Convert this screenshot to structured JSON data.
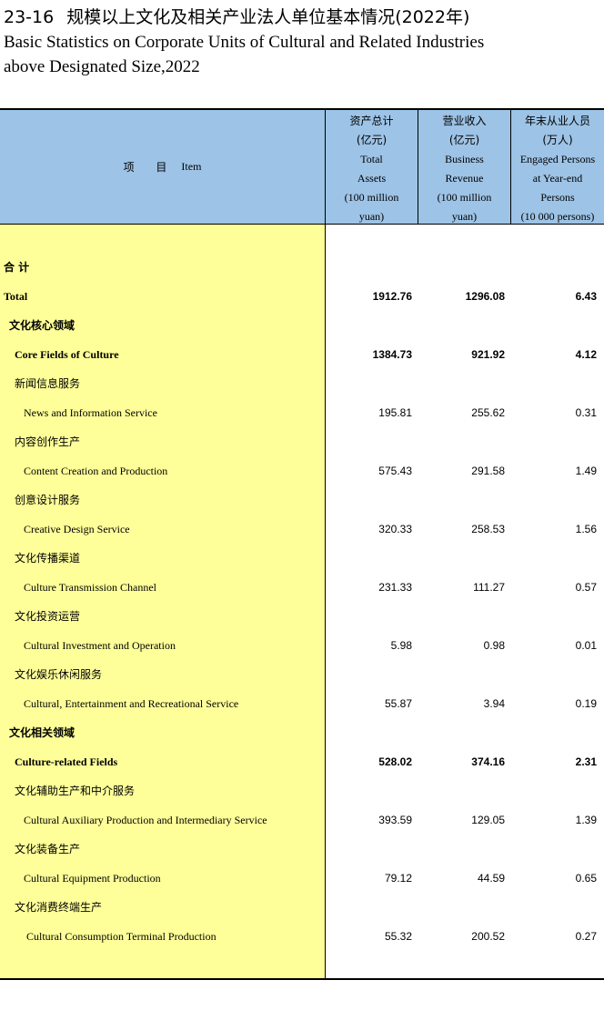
{
  "title": {
    "number": "23-16",
    "cn": "规模以上文化及相关产业法人单位基本情况(2022年)",
    "en_line1": "Basic Statistics on Corporate Units of Cultural and Related Industries",
    "en_line2": "above Designated Size,2022"
  },
  "header": {
    "item_cn": "项 目",
    "item_en": "Item",
    "col1": [
      "资产总计",
      "(亿元)",
      "Total",
      "Assets",
      "(100 million",
      "yuan)"
    ],
    "col2": [
      "营业收入",
      "(亿元)",
      "Business",
      "Revenue",
      "(100 million",
      "yuan)"
    ],
    "col3": [
      "年末从业人员",
      "(万人)",
      "Engaged Persons",
      "at Year-end",
      "Persons",
      "(10 000 persons)"
    ]
  },
  "rows": [
    {
      "label": "合 计",
      "cn": true,
      "bold": true,
      "indent": 0
    },
    {
      "label": "Total",
      "bold": true,
      "indent": 0,
      "v1": "1912.76",
      "v2": "1296.08",
      "v3": "6.43"
    },
    {
      "label": "文化核心领域",
      "cn": true,
      "bold": true,
      "indent": 1
    },
    {
      "label": "Core Fields of Culture",
      "bold": true,
      "indent": 2,
      "v1": "1384.73",
      "v2": "921.92",
      "v3": "4.12"
    },
    {
      "label": "新闻信息服务",
      "cn": true,
      "indent": 2
    },
    {
      "label": "News and Information Service",
      "indent": 3,
      "v1": "195.81",
      "v2": "255.62",
      "v3": "0.31"
    },
    {
      "label": "内容创作生产",
      "cn": true,
      "indent": 2
    },
    {
      "label": "Content Creation and Production",
      "indent": 3,
      "v1": "575.43",
      "v2": "291.58",
      "v3": "1.49"
    },
    {
      "label": "创意设计服务",
      "cn": true,
      "indent": 2
    },
    {
      "label": "Creative Design Service",
      "indent": 3,
      "v1": "320.33",
      "v2": "258.53",
      "v3": "1.56"
    },
    {
      "label": "文化传播渠道",
      "cn": true,
      "indent": 2
    },
    {
      "label": "Culture Transmission Channel",
      "indent": 3,
      "v1": "231.33",
      "v2": "111.27",
      "v3": "0.57"
    },
    {
      "label": "文化投资运营",
      "cn": true,
      "indent": 2
    },
    {
      "label": "Cultural Investment and Operation",
      "indent": 3,
      "v1": "5.98",
      "v2": "0.98",
      "v3": "0.01"
    },
    {
      "label": "文化娱乐休闲服务",
      "cn": true,
      "indent": 2
    },
    {
      "label": "Cultural, Entertainment and Recreational Service",
      "indent": 3,
      "v1": "55.87",
      "v2": "3.94",
      "v3": "0.19"
    },
    {
      "label": "文化相关领域",
      "cn": true,
      "bold": true,
      "indent": 1
    },
    {
      "label": "Culture-related Fields",
      "bold": true,
      "indent": 2,
      "v1": "528.02",
      "v2": "374.16",
      "v3": "2.31"
    },
    {
      "label": "文化辅助生产和中介服务",
      "cn": true,
      "indent": 2
    },
    {
      "label": "Cultural Auxiliary Production and Intermediary Service",
      "indent": 3,
      "v1": "393.59",
      "v2": "129.05",
      "v3": "1.39"
    },
    {
      "label": "文化装备生产",
      "cn": true,
      "indent": 2
    },
    {
      "label": "Cultural Equipment Production",
      "indent": 3,
      "v1": "79.12",
      "v2": "44.59",
      "v3": "0.65"
    },
    {
      "label": "文化消费终端生产",
      "cn": true,
      "indent": 2
    },
    {
      "label": "Cultural Consumption Terminal Production",
      "indent": 4,
      "v1": "55.32",
      "v2": "200.52",
      "v3": "0.27"
    }
  ]
}
